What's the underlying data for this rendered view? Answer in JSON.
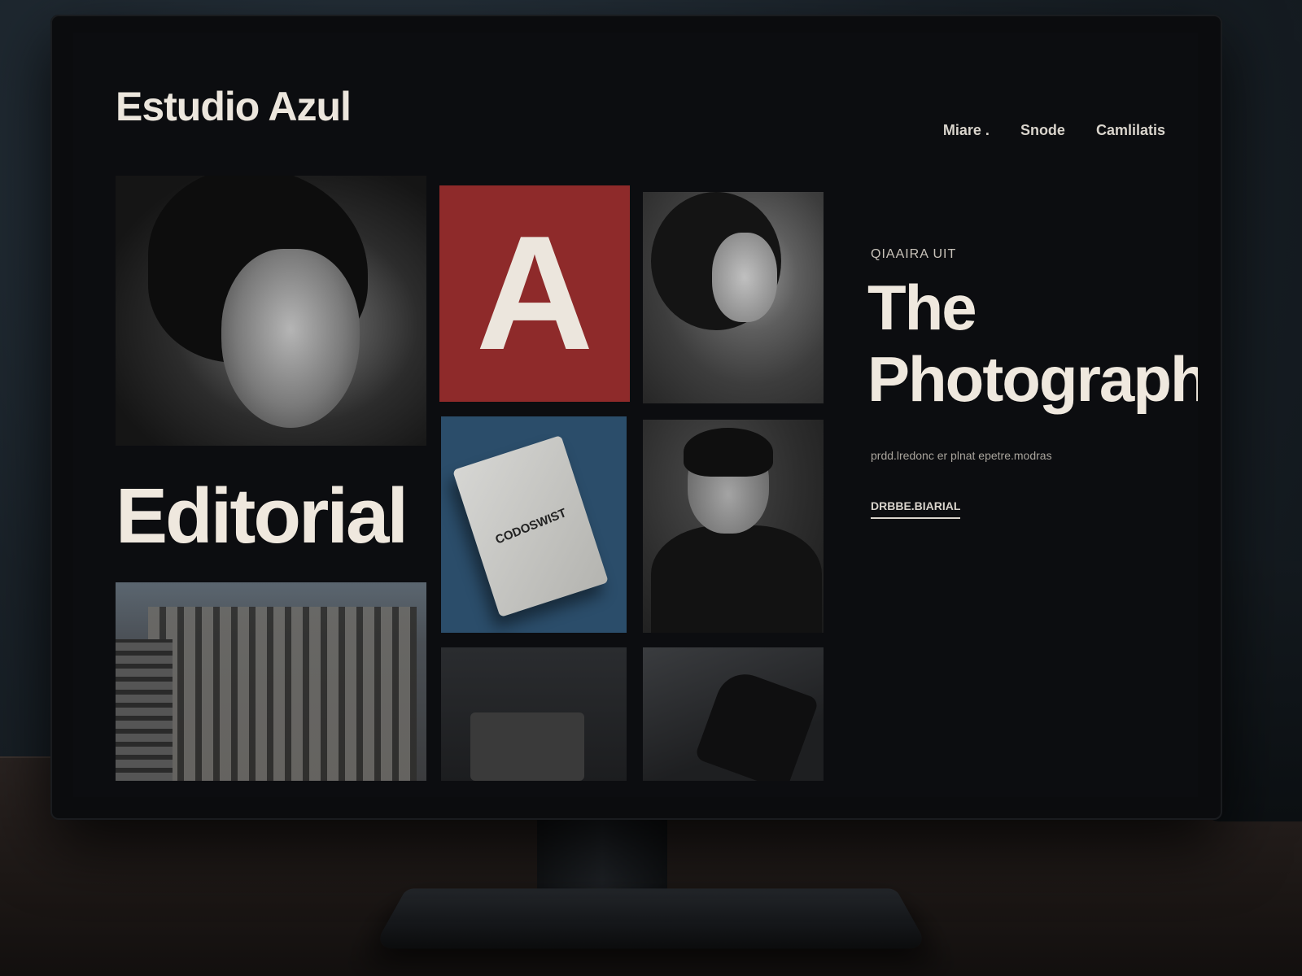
{
  "site": {
    "brand": "Estudio Azul"
  },
  "nav": {
    "items": [
      "Miare .",
      "Snode",
      "Camlilatis"
    ]
  },
  "gallery": {
    "section_label": "Editorial",
    "tile_letter": "A",
    "book_cover_text": "CODOSWIST"
  },
  "hero": {
    "eyebrow": "QIAAIRA UIT",
    "headline_line1": "The",
    "headline_line2": "Photographer",
    "body": "prdd.lredonc er plnat epetre.modras",
    "cta": "DRBBE.BIARIAL"
  },
  "colors": {
    "background": "#0c0d10",
    "red_tile": "#8e2a2a",
    "blue_tile": "#2b4d6a",
    "text_primary": "#efe8de"
  }
}
